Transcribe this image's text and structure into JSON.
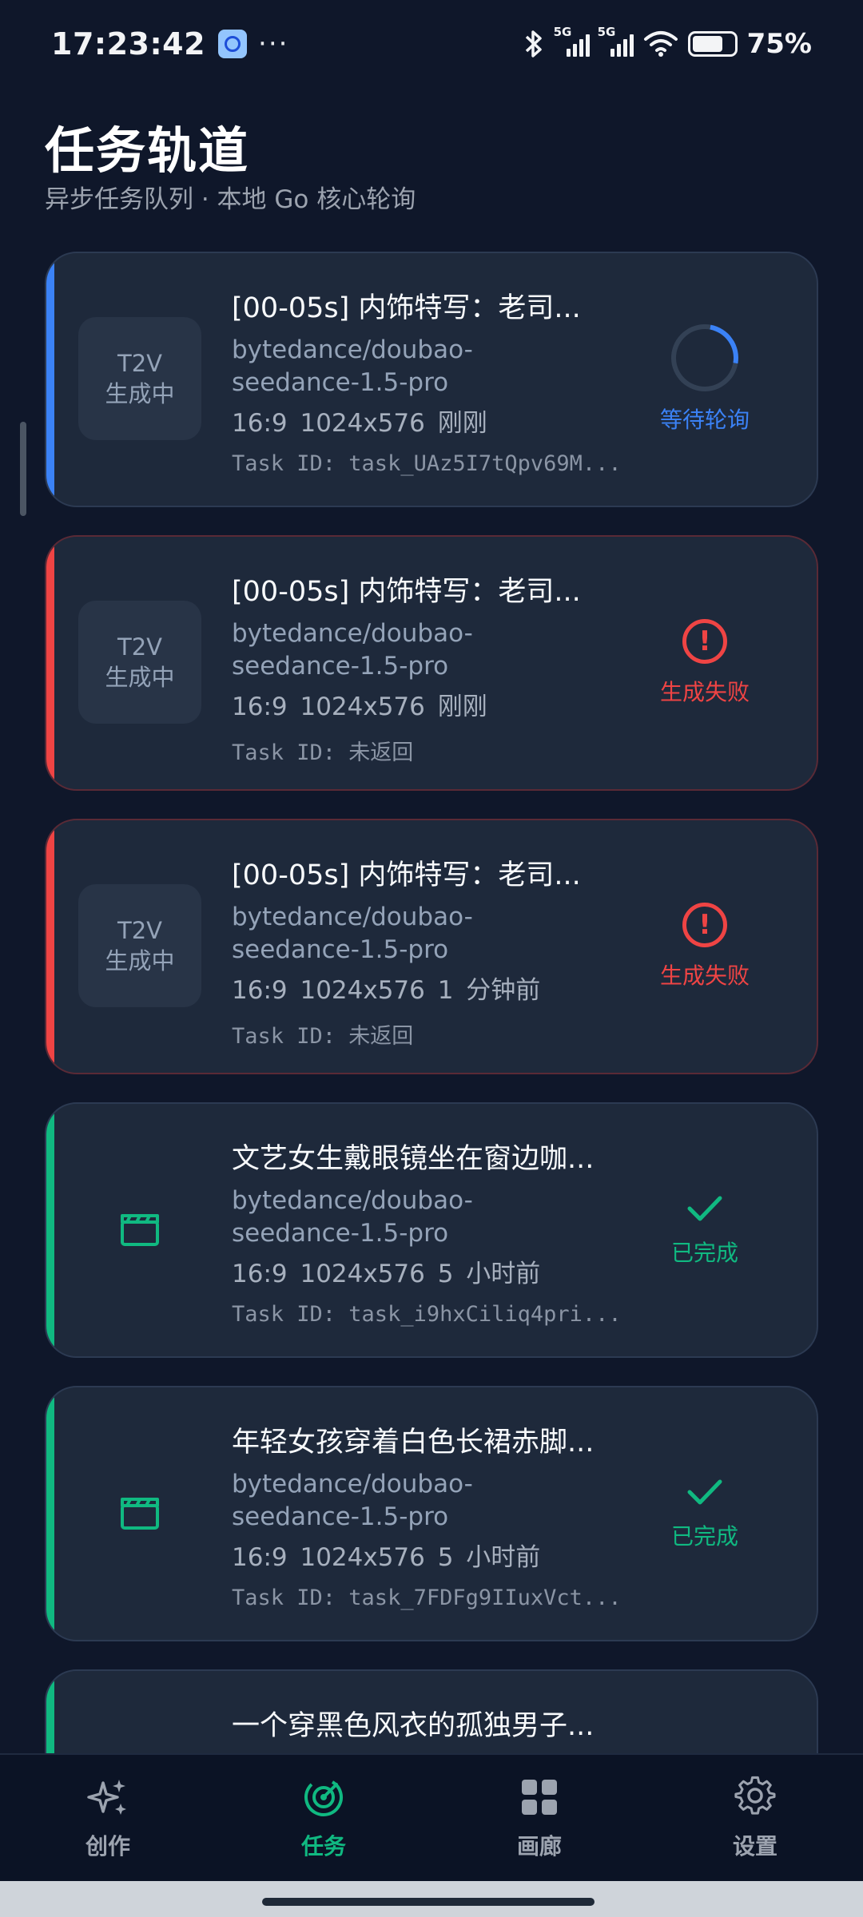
{
  "status_bar": {
    "time": "17:23:42",
    "more": "···",
    "network_label_1": "5G",
    "network_label_2": "5G",
    "battery_percent": "75%",
    "battery_level": 0.75
  },
  "header": {
    "title": "任务轨道",
    "subtitle": "异步任务队列 · 本地 Go 核心轮询"
  },
  "colors": {
    "background": "#0f172a",
    "card": "#1e293b",
    "pending": "#3b82f6",
    "failed": "#ef4444",
    "done": "#10b981"
  },
  "tasks": [
    {
      "status": "pending",
      "thumb_line1": "T2V",
      "thumb_line2": "生成中",
      "title": "[00-05s] 内饰特写：老司...",
      "model_line1": "bytedance/doubao-",
      "model_line2": "seedance-1.5-pro",
      "meta": "16:9   1024x576   刚刚",
      "task_id": "Task ID: task_UAz5I7tQpv69M...",
      "status_label": "等待轮询",
      "icon": "spinner-icon"
    },
    {
      "status": "failed",
      "thumb_line1": "T2V",
      "thumb_line2": "生成中",
      "title": "[00-05s] 内饰特写：老司...",
      "model_line1": "bytedance/doubao-",
      "model_line2": "seedance-1.5-pro",
      "meta": "16:9   1024x576   刚刚",
      "task_id": "Task ID: 未返回",
      "status_label": "生成失败",
      "icon": "alert-icon"
    },
    {
      "status": "failed",
      "thumb_line1": "T2V",
      "thumb_line2": "生成中",
      "title": "[00-05s] 内饰特写：老司...",
      "model_line1": "bytedance/doubao-",
      "model_line2": "seedance-1.5-pro",
      "meta": "16:9   1024x576   1 分钟前",
      "task_id": "Task ID: 未返回",
      "status_label": "生成失败",
      "icon": "alert-icon"
    },
    {
      "status": "done",
      "title": "文艺女生戴眼镜坐在窗边咖...",
      "model_line1": "bytedance/doubao-",
      "model_line2": "seedance-1.5-pro",
      "meta": "16:9   1024x576   5 小时前",
      "task_id": "Task ID: task_i9hxCiliq4pri...",
      "status_label": "已完成",
      "icon": "checkmark-icon",
      "thumb_icon": "clapperboard-icon"
    },
    {
      "status": "done",
      "title": "年轻女孩穿着白色长裙赤脚...",
      "model_line1": "bytedance/doubao-",
      "model_line2": "seedance-1.5-pro",
      "meta": "16:9   1024x576   5 小时前",
      "task_id": "Task ID: task_7FDFg9IIuxVct...",
      "status_label": "已完成",
      "icon": "checkmark-icon",
      "thumb_icon": "clapperboard-icon"
    },
    {
      "status": "done",
      "title": "一个穿黑色风衣的孤独男子..."
    }
  ],
  "nav": {
    "create": "创作",
    "tasks": "任务",
    "gallery": "画廊",
    "settings": "设置",
    "active": "tasks"
  }
}
